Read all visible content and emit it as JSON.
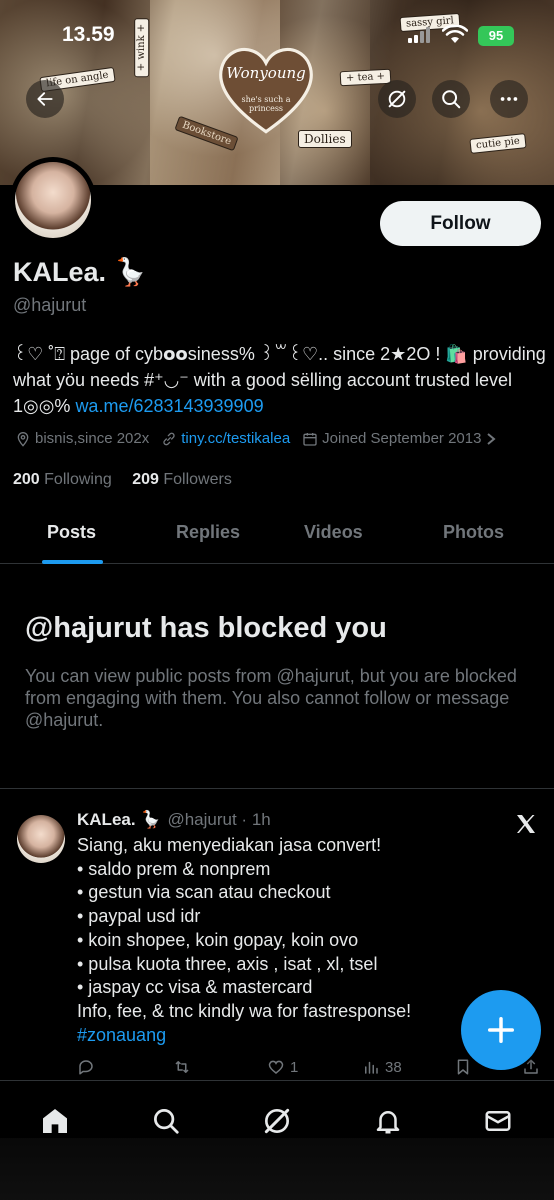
{
  "status_bar": {
    "time": "13.59",
    "battery": "95"
  },
  "banner": {
    "stickers": [
      "life on angle",
      "+ wink +",
      "sassy girl",
      "+ tea +",
      "Dollies",
      "cutie pie",
      "Bookstore"
    ],
    "heart_title": "Wonyoung",
    "heart_subtitle": "she's such a princess"
  },
  "profile": {
    "follow_label": "Follow",
    "name": "KALea. 🪿",
    "handle": "@hajurut",
    "bio_text": "꒰♡ ˚⍰ page of cyb𝗼𝗼siness% ꒱꒳꒰♡.. since 2★2O ! 🛍️ providing what yöu needs #⁺◡⁻ with a good sëlling account trusted level 1◎◎% ",
    "bio_link": "wa.me/6283143939909",
    "location": "bisnis,since 202x",
    "website": "tiny.cc/testikalea",
    "joined": "Joined September 2013",
    "following_count": "200",
    "following_label": "Following",
    "followers_count": "209",
    "followers_label": "Followers"
  },
  "tabs": [
    {
      "label": "Posts",
      "active": true
    },
    {
      "label": "Replies",
      "active": false
    },
    {
      "label": "Videos",
      "active": false
    },
    {
      "label": "Photos",
      "active": false
    }
  ],
  "blocked": {
    "title": "@hajurut has blocked you",
    "description": "You can view public posts from @hajurut, but you are blocked from engaging with them. You also cannot follow or message @hajurut."
  },
  "post": {
    "author_name": "KALea. 🪿",
    "author_meta": "@hajurut · 1h",
    "lines": [
      "Siang, aku menyediakan jasa convert!",
      "• saldo prem & nonprem",
      "• gestun via scan atau checkout",
      "• paypal usd idr",
      "• koin shopee, koin gopay, koin ovo",
      "• pulsa kuota three, axis , isat , xl, tsel",
      "• jaspay cc visa & mastercard",
      "Info, fee, & tnc kindly wa for fastresponse!"
    ],
    "hashtag": "#zonauang",
    "like_count": "1",
    "view_count": "38"
  },
  "colors": {
    "accent": "#1d9bf0",
    "muted": "#71767b",
    "text": "#e7e9ea",
    "battery": "#34c759"
  },
  "icons": {
    "back": "arrow-left-icon",
    "grok": "grok-icon",
    "search": "search-icon",
    "more": "more-icon",
    "nav": [
      "home-icon",
      "search-icon",
      "grok-icon",
      "bell-icon",
      "mail-icon"
    ]
  }
}
